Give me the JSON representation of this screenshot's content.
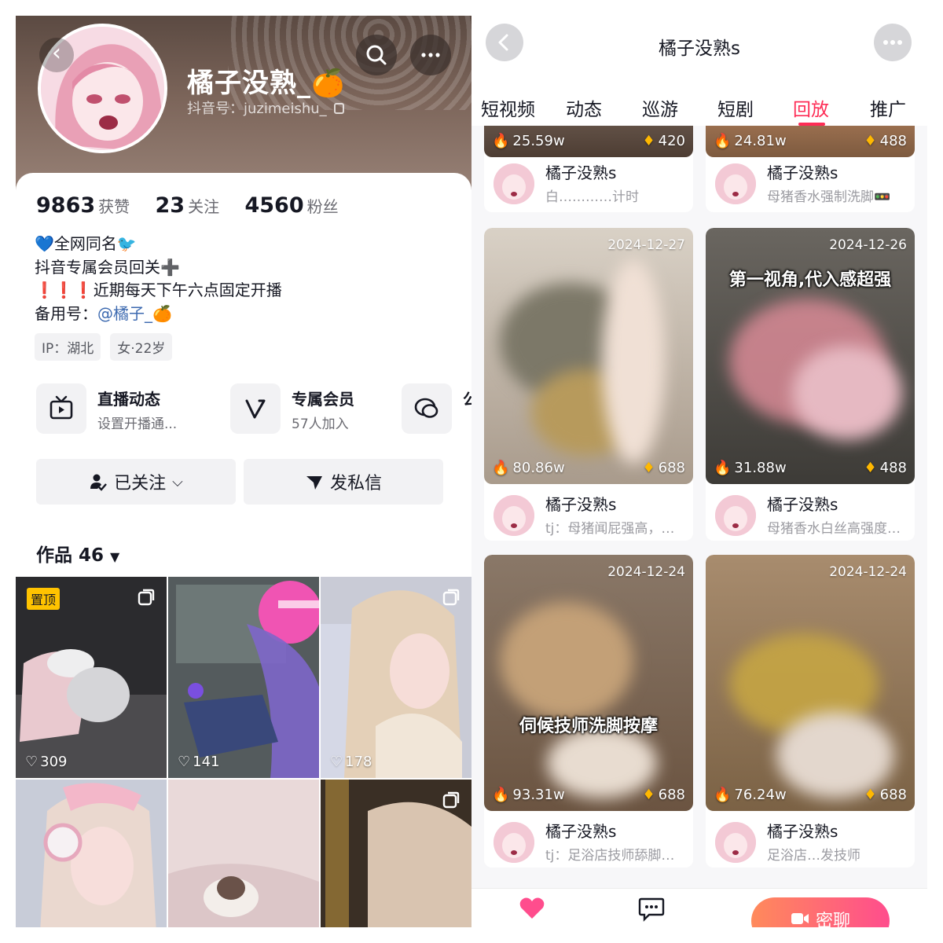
{
  "profile": {
    "name": "橘子没熟_",
    "name_emoji": "🍊",
    "douyin_id": "抖音号：juzimeishu_",
    "stats": [
      {
        "value": "9863",
        "label": "获赞"
      },
      {
        "value": "23",
        "label": "关注"
      },
      {
        "value": "4560",
        "label": "粉丝"
      }
    ],
    "bio": [
      "💙全网同名🐦",
      "抖音专属会员回关➕",
      "❗❗❗近期每天下午六点固定开播"
    ],
    "backup_label": "备用号：",
    "backup_link": "@橘子_🍊",
    "tags": [
      "IP：湖北",
      "女·22岁"
    ],
    "features": [
      {
        "title": "直播动态",
        "subtitle": "设置开播通..."
      },
      {
        "title": "专属会员",
        "subtitle": "57人加入"
      },
      {
        "title": "公",
        "subtitle": ""
      }
    ],
    "follow_button": "已关注",
    "message_button": "发私信",
    "works_label": "作品 46",
    "pinned_label": "置顶",
    "works": [
      {
        "likes": "309",
        "pinned": true,
        "multi": true
      },
      {
        "likes": "141",
        "pinned": false,
        "multi": false
      },
      {
        "likes": "178",
        "pinned": false,
        "multi": true
      },
      {
        "likes": "",
        "pinned": false,
        "multi": false
      },
      {
        "likes": "",
        "pinned": false,
        "multi": false
      },
      {
        "likes": "",
        "pinned": false,
        "multi": true
      }
    ]
  },
  "replay": {
    "title": "橘子没熟s",
    "tabs": [
      "短视频",
      "动态",
      "巡游",
      "短剧",
      "回放",
      "推广"
    ],
    "active_tab": "回放",
    "top_row": [
      {
        "views": "25.59w",
        "diamonds": "420",
        "name": "橘子没熟s",
        "desc": "白…………计时"
      },
      {
        "views": "24.81w",
        "diamonds": "488",
        "name": "橘子没熟s",
        "desc": "母猪香水强制洗脚🚥"
      }
    ],
    "videos": [
      {
        "date": "2024-12-27",
        "views": "80.86w",
        "diamonds": "688",
        "name": "橘子没熟s",
        "desc": "tj：母猪闻屁强高，…",
        "overlay": "",
        "overlay_bottom": ""
      },
      {
        "date": "2024-12-26",
        "views": "31.88w",
        "diamonds": "488",
        "name": "橘子没熟s",
        "desc": "母猪香水白丝高强度…",
        "overlay": "第一视角,代入感超强",
        "overlay_bottom": ""
      },
      {
        "date": "2024-12-24",
        "views": "93.31w",
        "diamonds": "688",
        "name": "橘子没熟s",
        "desc": "tj：足浴店技师舔脚…",
        "overlay": "",
        "overlay_bottom": "伺候技师洗脚按摩"
      },
      {
        "date": "2024-12-24",
        "views": "76.24w",
        "diamonds": "688",
        "name": "橘子没熟s",
        "desc": "足浴店…发技师",
        "overlay": "",
        "overlay_bottom": ""
      }
    ],
    "chat_button": "密聊"
  },
  "colors": {
    "accent": "#fe2c55",
    "pin": "#ffc300",
    "diamond": "#ffb800",
    "fire": "#ff3b30"
  }
}
